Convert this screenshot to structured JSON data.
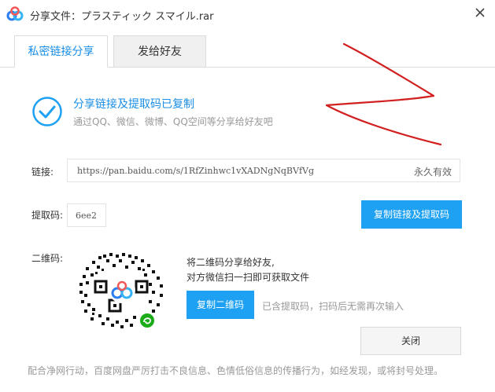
{
  "window": {
    "title": "分享文件：プラスティック スマイル.rar"
  },
  "tabs": [
    {
      "label": "私密链接分享",
      "active": true
    },
    {
      "label": "发给好友",
      "active": false
    }
  ],
  "status": {
    "title": "分享链接及提取码已复制",
    "subtitle": "通过QQ、微信、微博、QQ空间等分享给好友吧"
  },
  "link": {
    "label": "链接:",
    "url": "https://pan.baidu.com/s/1RfZinhwc1vXADNgNqBVfVg",
    "validity": "永久有效"
  },
  "code": {
    "label": "提取码:",
    "value": "6ee2"
  },
  "buttons": {
    "copy_link": "复制链接及提取码",
    "copy_qr": "复制二维码",
    "close": "关闭"
  },
  "qr": {
    "label": "二维码:",
    "desc_line1": "将二维码分享给好友,",
    "desc_line2": "对方微信扫一扫即可获取文件",
    "hint": "已含提取码，扫码后无需再次输入"
  },
  "footer": {
    "text": "配合净网行动，百度网盘严厉打击不良信息、色情低俗信息的传播行为，如经发现，或将封号处理。"
  },
  "colors": {
    "accent": "#1a8ee6",
    "button_blue": "#1ea1f2",
    "annotation_red": "#d21f1f"
  },
  "icons": [
    "baidu-netdisk-logo-icon",
    "close-icon",
    "check-circle-icon",
    "wechat-mini-program-icon"
  ]
}
